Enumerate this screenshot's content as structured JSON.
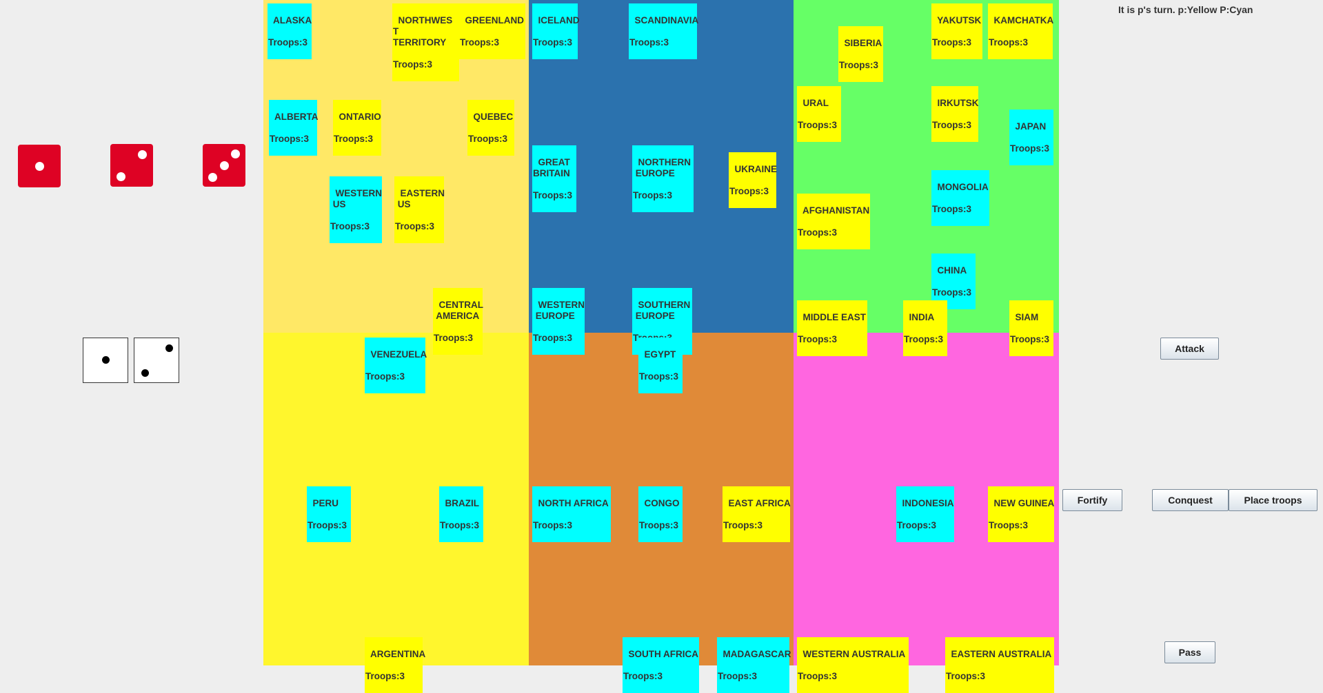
{
  "status_text": "It is p's turn.  p:Yellow  P:Cyan",
  "colors": {
    "north_america": "#ffe866",
    "south_america": "#fff62d",
    "europe": "#2b72ae",
    "africa": "#e08a38",
    "asia": "#66ff66",
    "australia": "#ff66e0",
    "cyan_player": "#00ffff",
    "yellow_player": "#ffff00"
  },
  "attack_dice": [
    1,
    2,
    3
  ],
  "defend_dice": [
    1,
    2
  ],
  "buttons": {
    "attack": "Attack",
    "fortify": "Fortify",
    "conquest": "Conquest",
    "place_troops": "Place troops",
    "pass": "Pass"
  },
  "territories": {
    "alaska": {
      "name": "ALASKA",
      "troops": "Troops:3",
      "owner": "cyan"
    },
    "northwest_territory": {
      "name": "NORTHWES\nT\nTERRITORY",
      "troops": "Troops:3",
      "owner": "yellow"
    },
    "greenland": {
      "name": "GREENLAND",
      "troops": "Troops:3",
      "owner": "yellow"
    },
    "alberta": {
      "name": "ALBERTA",
      "troops": "Troops:3",
      "owner": "cyan"
    },
    "ontario": {
      "name": "ONTARIO",
      "troops": "Troops:3",
      "owner": "yellow"
    },
    "quebec": {
      "name": "QUEBEC",
      "troops": "Troops:3",
      "owner": "yellow"
    },
    "western_us": {
      "name": "WESTERN\n US",
      "troops": "Troops:3",
      "owner": "cyan"
    },
    "eastern_us": {
      "name": "EASTERN\n US",
      "troops": "Troops:3",
      "owner": "yellow"
    },
    "central_america": {
      "name": "CENTRAL\n AMERICA",
      "troops": "Troops:3",
      "owner": "yellow"
    },
    "iceland": {
      "name": "ICELAND",
      "troops": "Troops:3",
      "owner": "cyan"
    },
    "scandinavia": {
      "name": "SCANDINAVIA",
      "troops": "Troops:3",
      "owner": "cyan"
    },
    "great_britain": {
      "name": "GREAT\nBRITAIN",
      "troops": "Troops:3",
      "owner": "cyan"
    },
    "northern_europe": {
      "name": "NORTHERN\n EUROPE",
      "troops": "Troops:3",
      "owner": "cyan"
    },
    "ukraine": {
      "name": "UKRAINE",
      "troops": "Troops:3",
      "owner": "yellow"
    },
    "western_europe": {
      "name": "WESTERN\n EUROPE",
      "troops": "Troops:3",
      "owner": "cyan"
    },
    "southern_europe": {
      "name": "SOUTHERN\n EUROPE",
      "troops": "Troops:3",
      "owner": "cyan"
    },
    "siberia": {
      "name": "SIBERIA",
      "troops": "Troops:3",
      "owner": "yellow"
    },
    "yakutsk": {
      "name": "YAKUTSK",
      "troops": "Troops:3",
      "owner": "yellow"
    },
    "kamchatka": {
      "name": "KAMCHATKA",
      "troops": "Troops:3",
      "owner": "yellow"
    },
    "ural": {
      "name": "URAL",
      "troops": "Troops:3",
      "owner": "yellow"
    },
    "irkutsk": {
      "name": "IRKUTSK",
      "troops": "Troops:3",
      "owner": "yellow"
    },
    "japan": {
      "name": "JAPAN",
      "troops": "Troops:3",
      "owner": "cyan"
    },
    "mongolia": {
      "name": "MONGOLIA",
      "troops": "Troops:3",
      "owner": "cyan"
    },
    "afghanistan": {
      "name": "AFGHANISTAN",
      "troops": "Troops:3",
      "owner": "yellow"
    },
    "china": {
      "name": "CHINA",
      "troops": "Troops:3",
      "owner": "cyan"
    },
    "middle_east": {
      "name": "MIDDLE EAST",
      "troops": "Troops:3",
      "owner": "yellow"
    },
    "india": {
      "name": "INDIA",
      "troops": "Troops:3",
      "owner": "yellow"
    },
    "siam": {
      "name": "SIAM",
      "troops": "Troops:3",
      "owner": "yellow"
    },
    "venezuela": {
      "name": "VENEZUELA",
      "troops": "Troops:3",
      "owner": "cyan"
    },
    "peru": {
      "name": "PERU",
      "troops": "Troops:3",
      "owner": "cyan"
    },
    "brazil": {
      "name": "BRAZIL",
      "troops": "Troops:3",
      "owner": "cyan"
    },
    "argentina": {
      "name": "ARGENTINA",
      "troops": "Troops:3",
      "owner": "yellow"
    },
    "egypt": {
      "name": "EGYPT",
      "troops": "Troops:3",
      "owner": "cyan"
    },
    "north_africa": {
      "name": "NORTH AFRICA",
      "troops": "Troops:3",
      "owner": "cyan"
    },
    "congo": {
      "name": "CONGO",
      "troops": "Troops:3",
      "owner": "cyan"
    },
    "east_africa": {
      "name": "EAST AFRICA",
      "troops": "Troops:3",
      "owner": "yellow"
    },
    "south_africa": {
      "name": "SOUTH AFRICA",
      "troops": "Troops:3",
      "owner": "cyan"
    },
    "madagascar": {
      "name": "MADAGASCAR",
      "troops": "Troops:3",
      "owner": "cyan"
    },
    "indonesia": {
      "name": "INDONESIA",
      "troops": "Troops:3",
      "owner": "cyan"
    },
    "new_guinea": {
      "name": "NEW GUINEA",
      "troops": "Troops:3",
      "owner": "yellow"
    },
    "western_australia": {
      "name": "WESTERN AUSTRALIA",
      "troops": "Troops:3",
      "owner": "yellow"
    },
    "eastern_australia": {
      "name": "EASTERN AUSTRALIA",
      "troops": "Troops:3",
      "owner": "yellow"
    }
  }
}
